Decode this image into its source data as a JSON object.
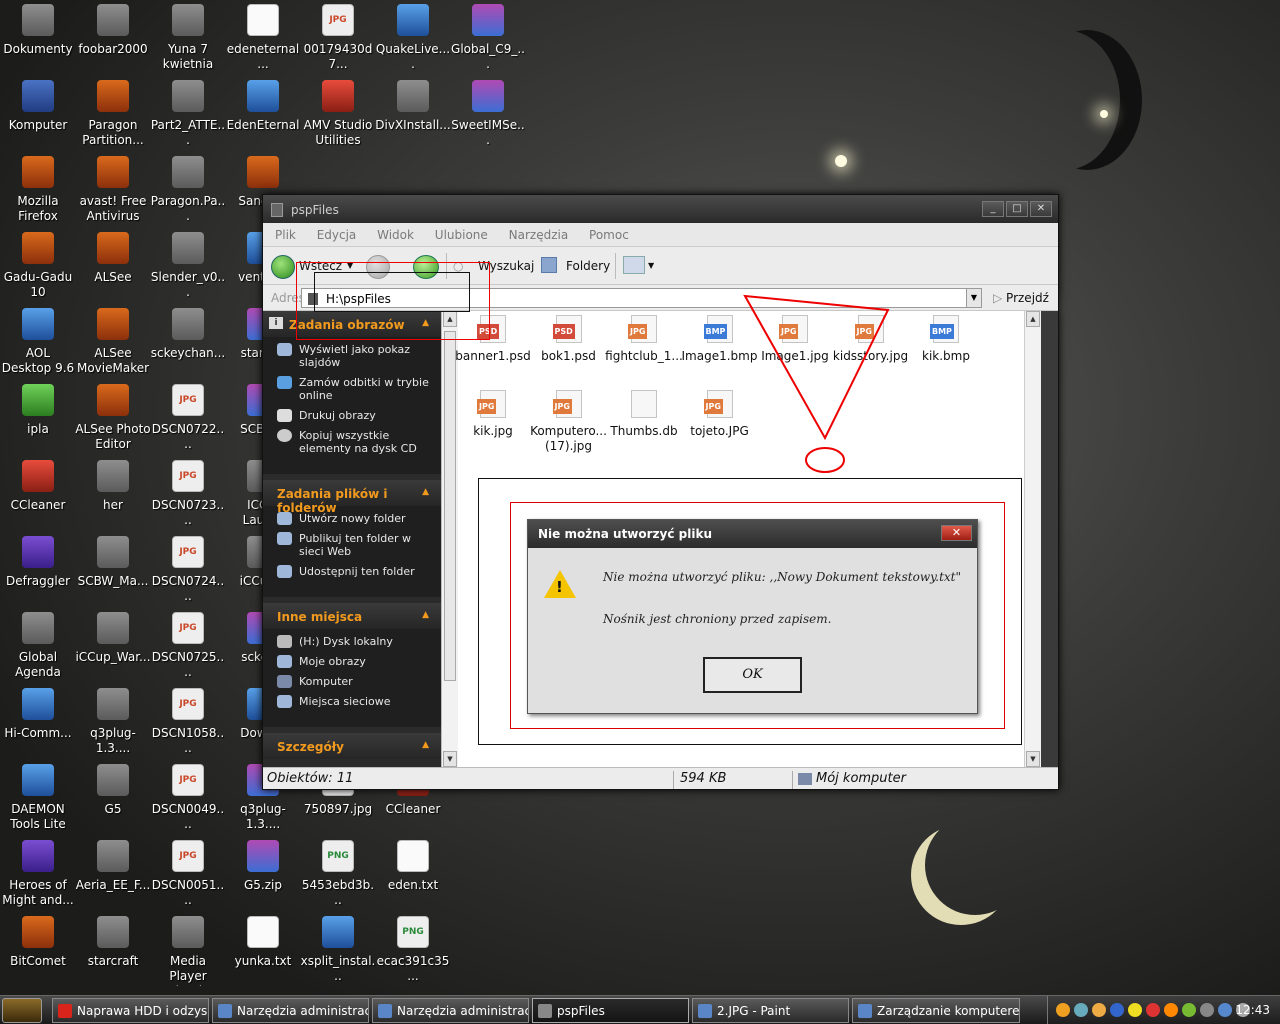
{
  "desktop_icons": [
    {
      "label": "Dokumenty",
      "icon": "grey"
    },
    {
      "label": "foobar2000",
      "icon": "grey"
    },
    {
      "label": "Yuna 7 kwietnia",
      "icon": "grey"
    },
    {
      "label": "edeneternal...",
      "icon": "txt"
    },
    {
      "label": "00179430d7...",
      "icon": "jpg"
    },
    {
      "label": "QuakeLive....",
      "icon": "blue"
    },
    {
      "label": "Global_C9_...",
      "icon": "rar"
    },
    {
      "label": "Komputer",
      "icon": "winlike"
    },
    {
      "label": "Paragon Partition...",
      "icon": "app"
    },
    {
      "label": "Part2_ATTE...",
      "icon": "grey"
    },
    {
      "label": "EdenEternal",
      "icon": "blue"
    },
    {
      "label": "AMV Studio Utilities",
      "icon": "red"
    },
    {
      "label": "DivXInstall...",
      "icon": "grey"
    },
    {
      "label": "SweetIMSe...",
      "icon": "rar"
    },
    {
      "label": "Mozilla Firefox",
      "icon": "app"
    },
    {
      "label": "avast! Free Antivirus",
      "icon": "app"
    },
    {
      "label": "Paragon.Pa...",
      "icon": "grey"
    },
    {
      "label": "Sandb...",
      "icon": "app"
    },
    {
      "label": "Gadu-Gadu 10",
      "icon": "app"
    },
    {
      "label": "ALSee",
      "icon": "app"
    },
    {
      "label": "Slender_v0...",
      "icon": "grey"
    },
    {
      "label": "ventril...",
      "icon": "blue"
    },
    {
      "label": "AOL Desktop 9.6",
      "icon": "blue"
    },
    {
      "label": "ALSee MovieMaker",
      "icon": "app"
    },
    {
      "label": "sckeychan...",
      "icon": "grey"
    },
    {
      "label": "starcr...",
      "icon": "rar"
    },
    {
      "label": "ipla",
      "icon": "green"
    },
    {
      "label": "ALSee Photo Editor",
      "icon": "app"
    },
    {
      "label": "DSCN0722....",
      "icon": "jpg"
    },
    {
      "label": "SCBW...",
      "icon": "rar"
    },
    {
      "label": "CCleaner",
      "icon": "red"
    },
    {
      "label": "her",
      "icon": "grey"
    },
    {
      "label": "DSCN0723....",
      "icon": "jpg"
    },
    {
      "label": "ICC... Laun...",
      "icon": "grey"
    },
    {
      "label": "Defraggler",
      "icon": "purple"
    },
    {
      "label": "SCBW_Ma...",
      "icon": "grey"
    },
    {
      "label": "DSCN0724....",
      "icon": "jpg"
    },
    {
      "label": "iCCup...",
      "icon": "grey"
    },
    {
      "label": "Global Agenda",
      "icon": "grey"
    },
    {
      "label": "iCCup_War...",
      "icon": "grey"
    },
    {
      "label": "DSCN0725....",
      "icon": "jpg"
    },
    {
      "label": "sckey...",
      "icon": "rar"
    },
    {
      "label": "Hi-Comm...",
      "icon": "blue"
    },
    {
      "label": "q3plug-1.3....",
      "icon": "grey"
    },
    {
      "label": "DSCN1058....",
      "icon": "jpg"
    },
    {
      "label": "Down...",
      "icon": "blue"
    },
    {
      "label": "DAEMON Tools Lite",
      "icon": "blue"
    },
    {
      "label": "G5",
      "icon": "grey"
    },
    {
      "label": "DSCN0049....",
      "icon": "jpg"
    },
    {
      "label": "q3plug-1.3....",
      "icon": "rar"
    },
    {
      "label": "750897.jpg",
      "icon": "jpg"
    },
    {
      "label": "CCleaner",
      "icon": "red"
    },
    {
      "label": "Heroes of Might and...",
      "icon": "purple"
    },
    {
      "label": "Aeria_EE_F...",
      "icon": "grey"
    },
    {
      "label": "DSCN0051....",
      "icon": "jpg"
    },
    {
      "label": "G5.zip",
      "icon": "rar"
    },
    {
      "label": "5453ebd3b...",
      "icon": "png"
    },
    {
      "label": "eden.txt",
      "icon": "txt"
    },
    {
      "label": "BitComet",
      "icon": "app"
    },
    {
      "label": "starcraft",
      "icon": "grey"
    },
    {
      "label": "Media Player Classic",
      "icon": "grey"
    },
    {
      "label": "yunka.txt",
      "icon": "txt"
    },
    {
      "label": "xsplit_instal...",
      "icon": "blue"
    },
    {
      "label": "ecac391c35...",
      "icon": "png"
    }
  ],
  "explorer": {
    "title": "pspFiles",
    "menu": [
      "Plik",
      "Edycja",
      "Widok",
      "Ulubione",
      "Narzędzia",
      "Pomoc"
    ],
    "toolbar": {
      "back": "Wstecz",
      "search": "Wyszukaj",
      "folders": "Foldery"
    },
    "address": {
      "label": "Adres",
      "value": "H:\\pspFiles",
      "go": "Przejdź"
    },
    "panels": [
      {
        "title": "Zadania obrazów",
        "items": [
          "Wyświetl jako pokaz slajdów",
          "Zamów odbitki w trybie online",
          "Drukuj obrazy",
          "Kopiuj wszystkie elementy na dysk CD"
        ]
      },
      {
        "title": "Zadania plików i folderów",
        "items": [
          "Utwórz nowy folder",
          "Publikuj ten folder w sieci Web",
          "Udostępnij ten folder"
        ]
      },
      {
        "title": "Inne miejsca",
        "items": [
          "(H:) Dysk lokalny",
          "Moje obrazy",
          "Komputer",
          "Miejsca sieciowe"
        ]
      },
      {
        "title": "Szczegóły",
        "items": []
      }
    ],
    "files": [
      {
        "name": "banner1.psd",
        "type": "PSD"
      },
      {
        "name": "bok1.psd",
        "type": "PSD"
      },
      {
        "name": "fightclub_1...",
        "type": "JPG"
      },
      {
        "name": "Image1.bmp",
        "type": "BMP"
      },
      {
        "name": "Image1.jpg",
        "type": "JPG"
      },
      {
        "name": "kidsstory.jpg",
        "type": "JPG"
      },
      {
        "name": "kik.bmp",
        "type": "BMP"
      },
      {
        "name": "kik.jpg",
        "type": "JPG"
      },
      {
        "name": "Komputero... (17).jpg",
        "type": "JPG"
      },
      {
        "name": "Thumbs.db",
        "type": ""
      },
      {
        "name": "tojeto.JPG",
        "type": "JPG"
      }
    ],
    "status": {
      "count": "Obiektów: 11",
      "size": "594 KB",
      "location": "Mój komputer"
    }
  },
  "dialog": {
    "title": "Nie można utworzyć pliku",
    "message": "Nie można utworzyć pliku: ,,Nowy Dokument tekstowy.txt\"",
    "detail": "Nośnik jest chroniony przed zapisem.",
    "ok": "OK",
    "close": "✕"
  },
  "taskbar": {
    "buttons": [
      {
        "label": "Naprawa HDD i odzysk...",
        "color": "#d8241a"
      },
      {
        "label": "Narzędzia administrac...",
        "color": "#5a86c8"
      },
      {
        "label": "Narzędzia administrac...",
        "color": "#5a86c8"
      },
      {
        "label": "pspFiles",
        "color": "#888888"
      },
      {
        "label": "2.JPG - Paint",
        "color": "#5a86c8"
      },
      {
        "label": "Zarządzanie komputerem",
        "color": "#5a86c8"
      }
    ],
    "clock": "12:43"
  }
}
